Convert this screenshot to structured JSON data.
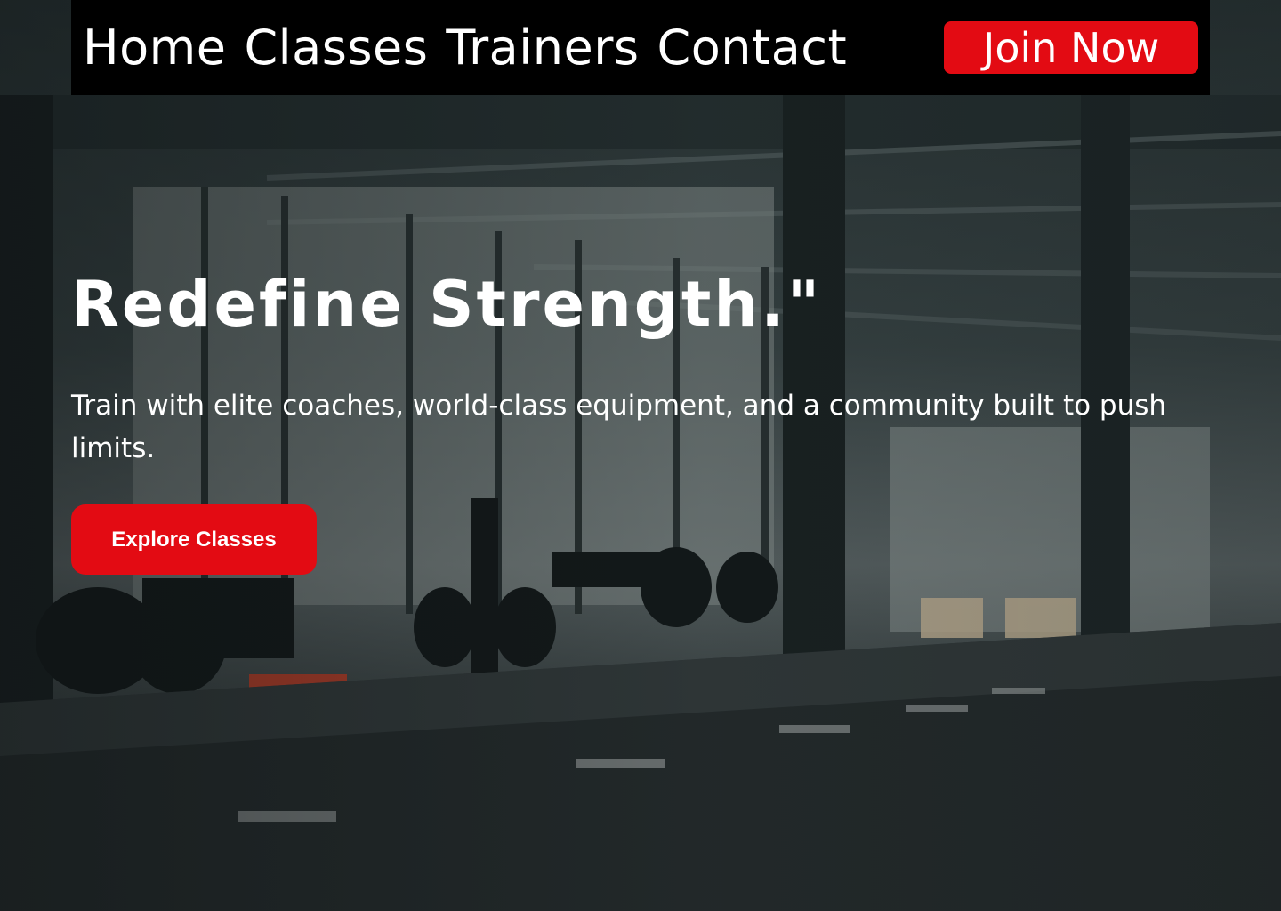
{
  "nav": {
    "links": [
      {
        "label": "Home"
      },
      {
        "label": "Classes"
      },
      {
        "label": "Trainers"
      },
      {
        "label": "Contact"
      }
    ],
    "cta_label": "Join Now"
  },
  "hero": {
    "title": "Redefine Strength.\"",
    "subtitle": "Train with elite coaches, world-class equipment, and a community built to push limits.",
    "cta_label": "Explore Classes"
  },
  "colors": {
    "accent": "#e30b13",
    "nav_bg": "#000000",
    "text": "#ffffff"
  }
}
